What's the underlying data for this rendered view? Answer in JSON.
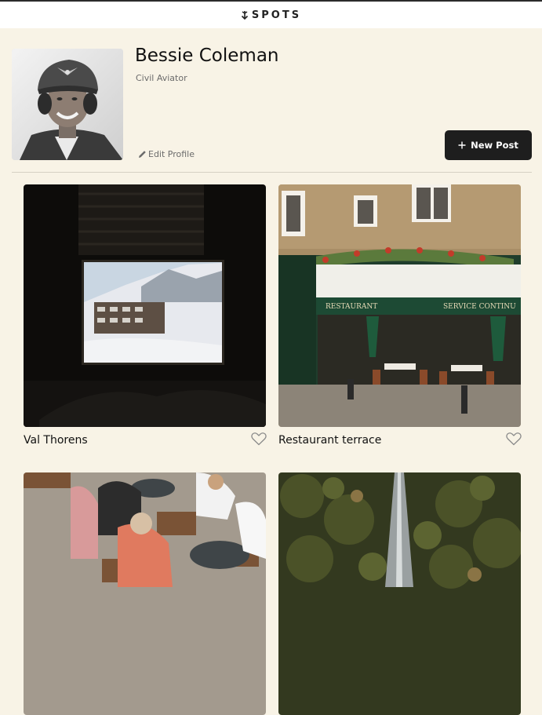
{
  "header": {
    "logo_text": "SPOTS",
    "logo_icon": "downward-arrow-sprout-icon"
  },
  "profile": {
    "name": "Bessie Coleman",
    "description": "Civil Aviator",
    "edit_label": "Edit Profile",
    "new_post_label": "New Post"
  },
  "cards": [
    {
      "title": "Val Thorens",
      "icon": "heart-outline-icon"
    },
    {
      "title": "Restaurant terrace",
      "icon": "heart-outline-icon"
    },
    {
      "title": "",
      "icon": ""
    },
    {
      "title": "",
      "icon": ""
    }
  ],
  "colors": {
    "background": "#f8f3e6",
    "header_bg": "#ffffff",
    "button_bg": "#1e1e1e",
    "button_text": "#ffffff",
    "muted_text": "#6b6b6b"
  }
}
